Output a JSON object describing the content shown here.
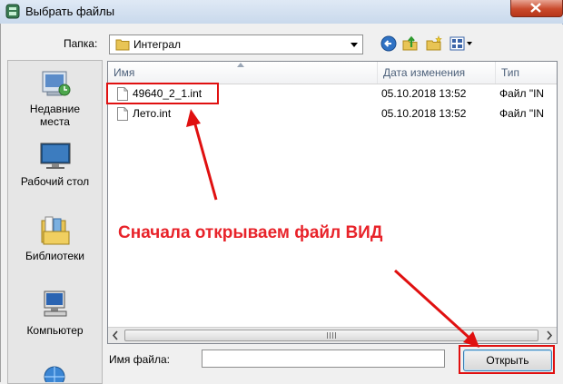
{
  "window": {
    "title": "Выбрать файлы"
  },
  "location": {
    "label": "Папка:",
    "current_folder": "Интеграл"
  },
  "places": [
    {
      "label": "Недавние места",
      "line1": "Недавние",
      "line2": "места",
      "icon": "recent-places-icon"
    },
    {
      "label": "Рабочий стол",
      "icon": "desktop-icon"
    },
    {
      "label": "Библиотеки",
      "icon": "libraries-icon"
    },
    {
      "label": "Компьютер",
      "icon": "computer-icon"
    }
  ],
  "file_list": {
    "columns": [
      "Имя",
      "Дата изменения",
      "Тип"
    ],
    "rows": [
      {
        "name": "49640_2_1.int",
        "date": "05.10.2018 13:52",
        "type": "Файл \"IN"
      },
      {
        "name": "Лето.int",
        "date": "05.10.2018 13:52",
        "type": "Файл \"IN"
      }
    ]
  },
  "filename": {
    "label": "Имя файла:",
    "value": ""
  },
  "buttons": {
    "open": "Открыть"
  },
  "annotation": {
    "text": "Сначала открываем файл ВИД",
    "color": "#e8232a"
  },
  "colors": {
    "title_bar": "#c9d9ec",
    "close": "#c94a2c",
    "highlight": "#e01010"
  }
}
